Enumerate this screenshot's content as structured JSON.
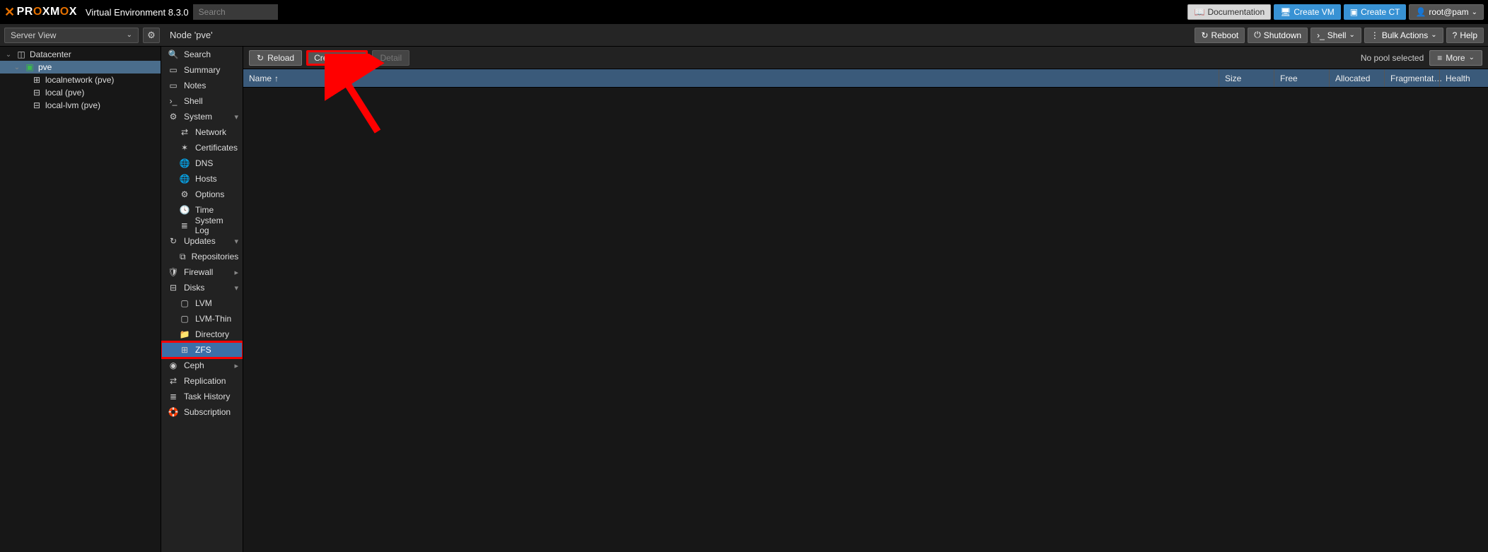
{
  "header": {
    "product_prefix": "PR",
    "product_o1": "O",
    "product_mid": "XM",
    "product_o2": "O",
    "product_suffix": "X",
    "version_label": "Virtual Environment 8.3.0",
    "search_placeholder": "Search",
    "doc_label": "Documentation",
    "create_vm_label": "Create VM",
    "create_ct_label": "Create CT",
    "user_label": "root@pam"
  },
  "secondbar": {
    "view_label": "Server View",
    "node_title": "Node 'pve'",
    "reboot_label": "Reboot",
    "shutdown_label": "Shutdown",
    "shell_label": "Shell",
    "bulk_label": "Bulk Actions",
    "help_label": "Help"
  },
  "tree": {
    "datacenter": "Datacenter",
    "pve": "pve",
    "localnetwork": "localnetwork (pve)",
    "local": "local (pve)",
    "locallvm": "local-lvm (pve)"
  },
  "sidebar": {
    "search": "Search",
    "summary": "Summary",
    "notes": "Notes",
    "shell": "Shell",
    "system": "System",
    "network": "Network",
    "certificates": "Certificates",
    "dns": "DNS",
    "hosts": "Hosts",
    "options": "Options",
    "time": "Time",
    "syslog": "System Log",
    "updates": "Updates",
    "repositories": "Repositories",
    "firewall": "Firewall",
    "disks": "Disks",
    "lvm": "LVM",
    "lvmthin": "LVM-Thin",
    "directory": "Directory",
    "zfs": "ZFS",
    "ceph": "Ceph",
    "replication": "Replication",
    "task_history": "Task History",
    "subscription": "Subscription"
  },
  "toolbar": {
    "reload": "Reload",
    "create_zfs": "Create: ZFS",
    "detail": "Detail",
    "no_pool": "No pool selected",
    "more": "More"
  },
  "grid": {
    "name": "Name",
    "size": "Size",
    "free": "Free",
    "allocated": "Allocated",
    "fragmentation": "Fragmentat…",
    "health": "Health"
  }
}
